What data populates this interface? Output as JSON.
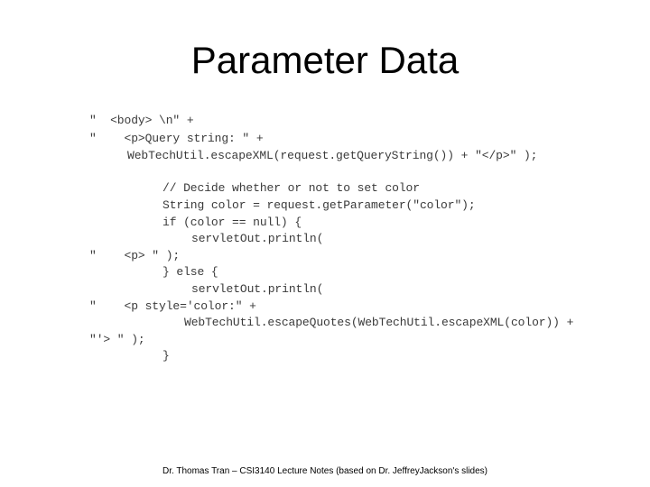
{
  "slide": {
    "title": "Parameter Data",
    "code_lines": [
      "\"  <body> \\n\" +",
      "\"    <p>Query string: \" +",
      "WebTechUtil.escapeXML(request.getQueryString()) + \"</p>\" );",
      "// Decide whether or not to set color",
      "String color = request.getParameter(\"color\");",
      "if (color == null) {",
      "servletOut.println(",
      "\"    <p> \" );",
      "} else {",
      "servletOut.println(",
      "\"    <p style='color:\" +",
      "WebTechUtil.escapeQuotes(WebTechUtil.escapeXML(color)) +",
      "\"'> \" );",
      "}"
    ],
    "footer": "Dr. Thomas Tran – CSI3140 Lecture Notes (based on Dr. JeffreyJackson's slides)"
  }
}
